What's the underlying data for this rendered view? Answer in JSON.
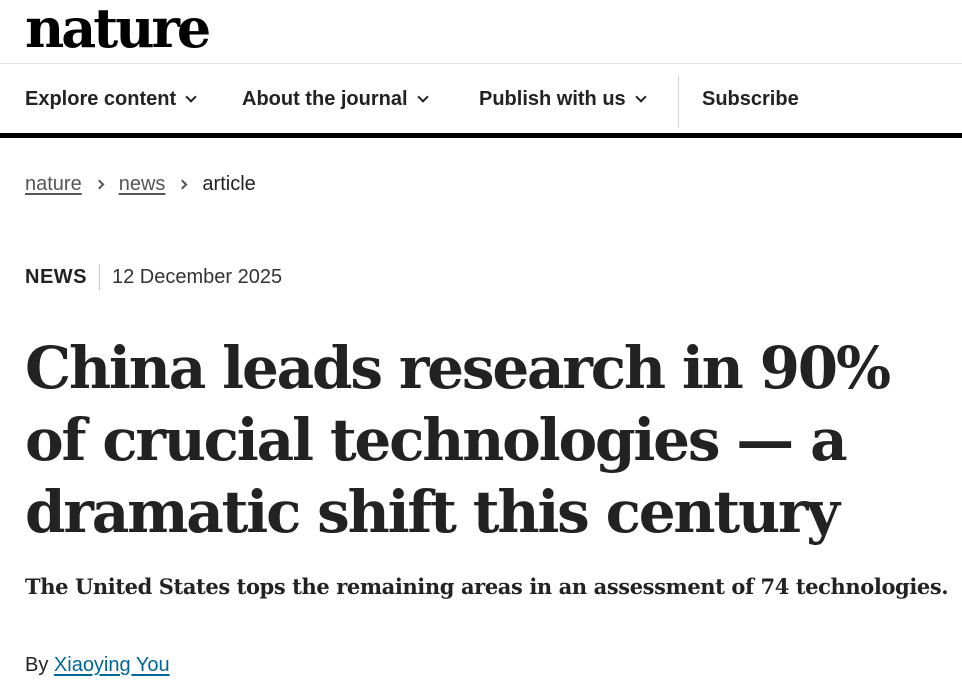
{
  "header": {
    "logo": "nature"
  },
  "nav": {
    "items": [
      {
        "label": "Explore content"
      },
      {
        "label": "About the journal"
      },
      {
        "label": "Publish with us"
      }
    ],
    "subscribe_label": "Subscribe"
  },
  "breadcrumb": {
    "items": [
      "nature",
      "news"
    ],
    "current": "article"
  },
  "article": {
    "type": "NEWS",
    "date": "12 December 2025",
    "title": "China leads research in 90% of crucial technologies — a dramatic shift this century",
    "standfirst": "The United States tops the remaining areas in an assessment of 74 technologies.",
    "byline_prefix": "By",
    "author": "Xiaoying You"
  }
}
